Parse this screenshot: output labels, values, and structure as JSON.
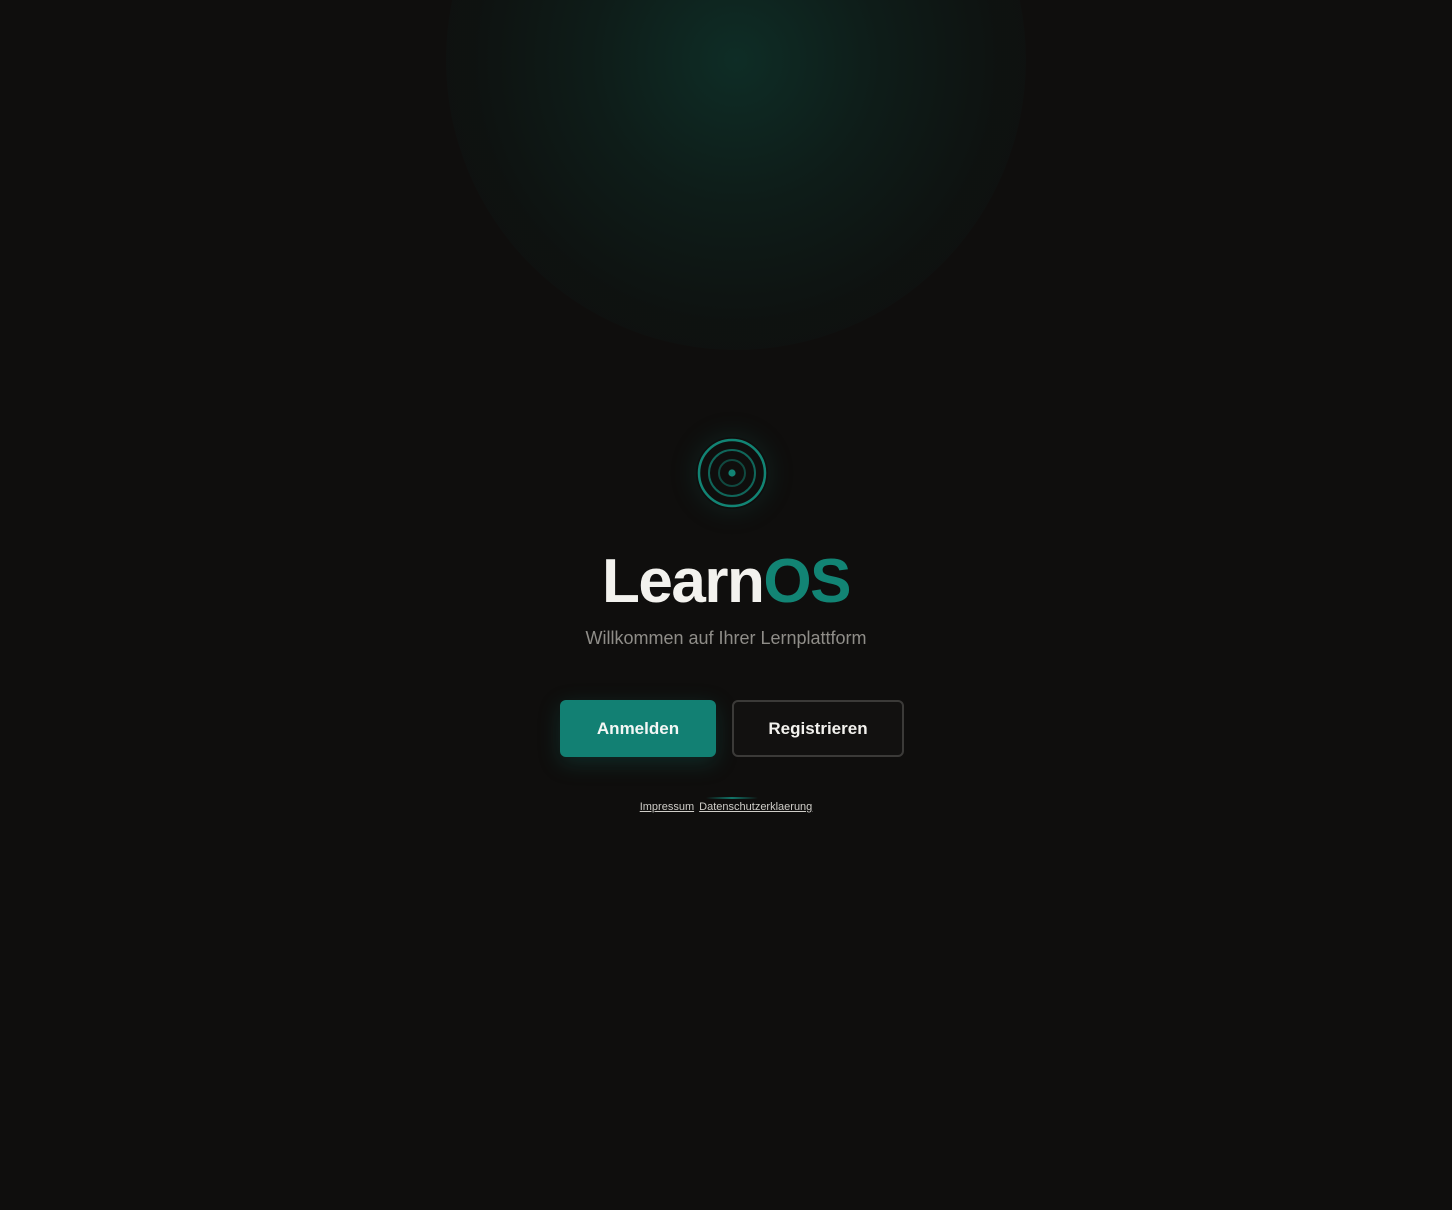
{
  "brand": {
    "name_part1": "Learn",
    "name_part2": "OS",
    "logo_icon": "concentric-circles-icon"
  },
  "tagline": "Willkommen auf Ihrer Lernplattform",
  "actions": {
    "login_label": "Anmelden",
    "register_label": "Registrieren"
  },
  "footer": {
    "imprint_label": "Impressum",
    "privacy_label": "Datenschutzerklaerung"
  },
  "colors": {
    "accent": "#128073",
    "background": "#0f0e0d",
    "text_primary": "#f3f2ee",
    "text_muted": "#8f8d88"
  }
}
